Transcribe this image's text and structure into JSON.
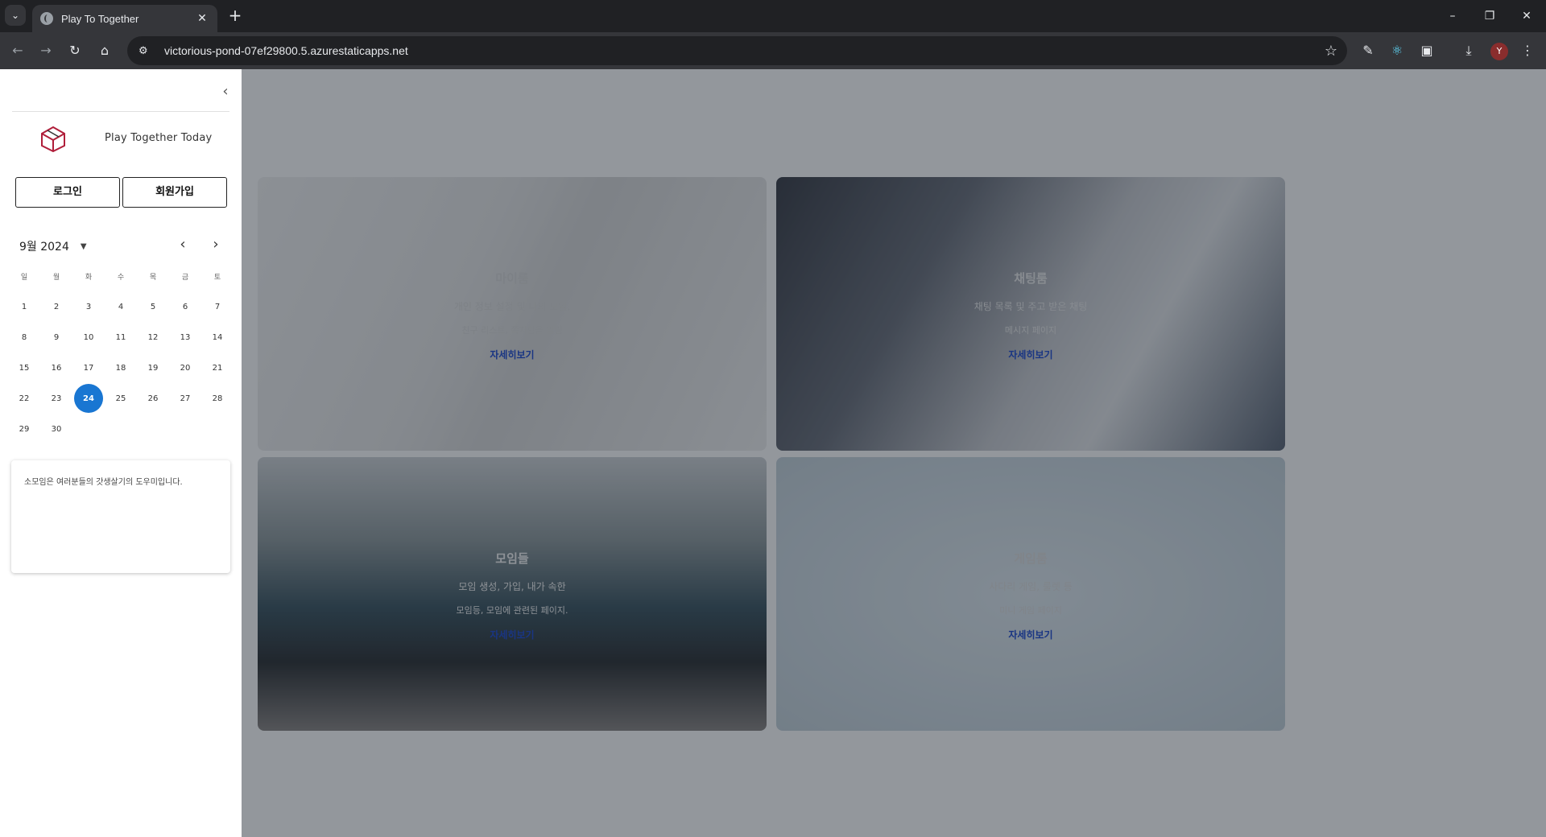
{
  "browser": {
    "tab_title": "Play To Together",
    "url": "victorious-pond-07ef29800.5.azurestaticapps.net",
    "profile_initial": "Y"
  },
  "sidebar": {
    "brand": "Play Together Today",
    "login_label": "로그인",
    "signup_label": "회원가입",
    "calendar": {
      "month_label": "9월 2024",
      "weekdays": [
        "일",
        "월",
        "화",
        "수",
        "목",
        "금",
        "토"
      ],
      "weeks": [
        [
          "1",
          "2",
          "3",
          "4",
          "5",
          "6",
          "7"
        ],
        [
          "8",
          "9",
          "10",
          "11",
          "12",
          "13",
          "14"
        ],
        [
          "15",
          "16",
          "17",
          "18",
          "19",
          "20",
          "21"
        ],
        [
          "22",
          "23",
          "24",
          "25",
          "26",
          "27",
          "28"
        ],
        [
          "29",
          "30",
          "",
          "",
          "",
          "",
          ""
        ]
      ],
      "selected_day": "24"
    },
    "notice_text": "소모임은 여러분들의 갓생살기의 도우미입니다."
  },
  "cards": [
    {
      "title": "마이룸",
      "desc1": "개인 정보 설정 및 나의 모임,",
      "desc2": "친구 리스트, 쪽지함을 알림",
      "link": "자세히보기",
      "text_color": "#d7d7d7"
    },
    {
      "title": "채팅룸",
      "desc1": "채팅 목록 및 주고 받은 채팅",
      "desc2": "메시지 페이지",
      "link": "자세히보기",
      "text_color": "#e9e9e9"
    },
    {
      "title": "모임들",
      "desc1": "모임 생성, 가입, 내가 속한",
      "desc2": "모임등, 모임에 관련된 페이지.",
      "link": "자세히보기",
      "text_color": "#f4f4f4"
    },
    {
      "title": "게임룸",
      "desc1": "사다리 게임, 룰렛 등",
      "desc2": "미니 게임 페이지",
      "link": "자세히보기",
      "text_color": "#dcdcdc"
    }
  ],
  "colors": {
    "accent": "#1976d2",
    "link": "#1f4ad1",
    "overlay": "#141c28"
  }
}
